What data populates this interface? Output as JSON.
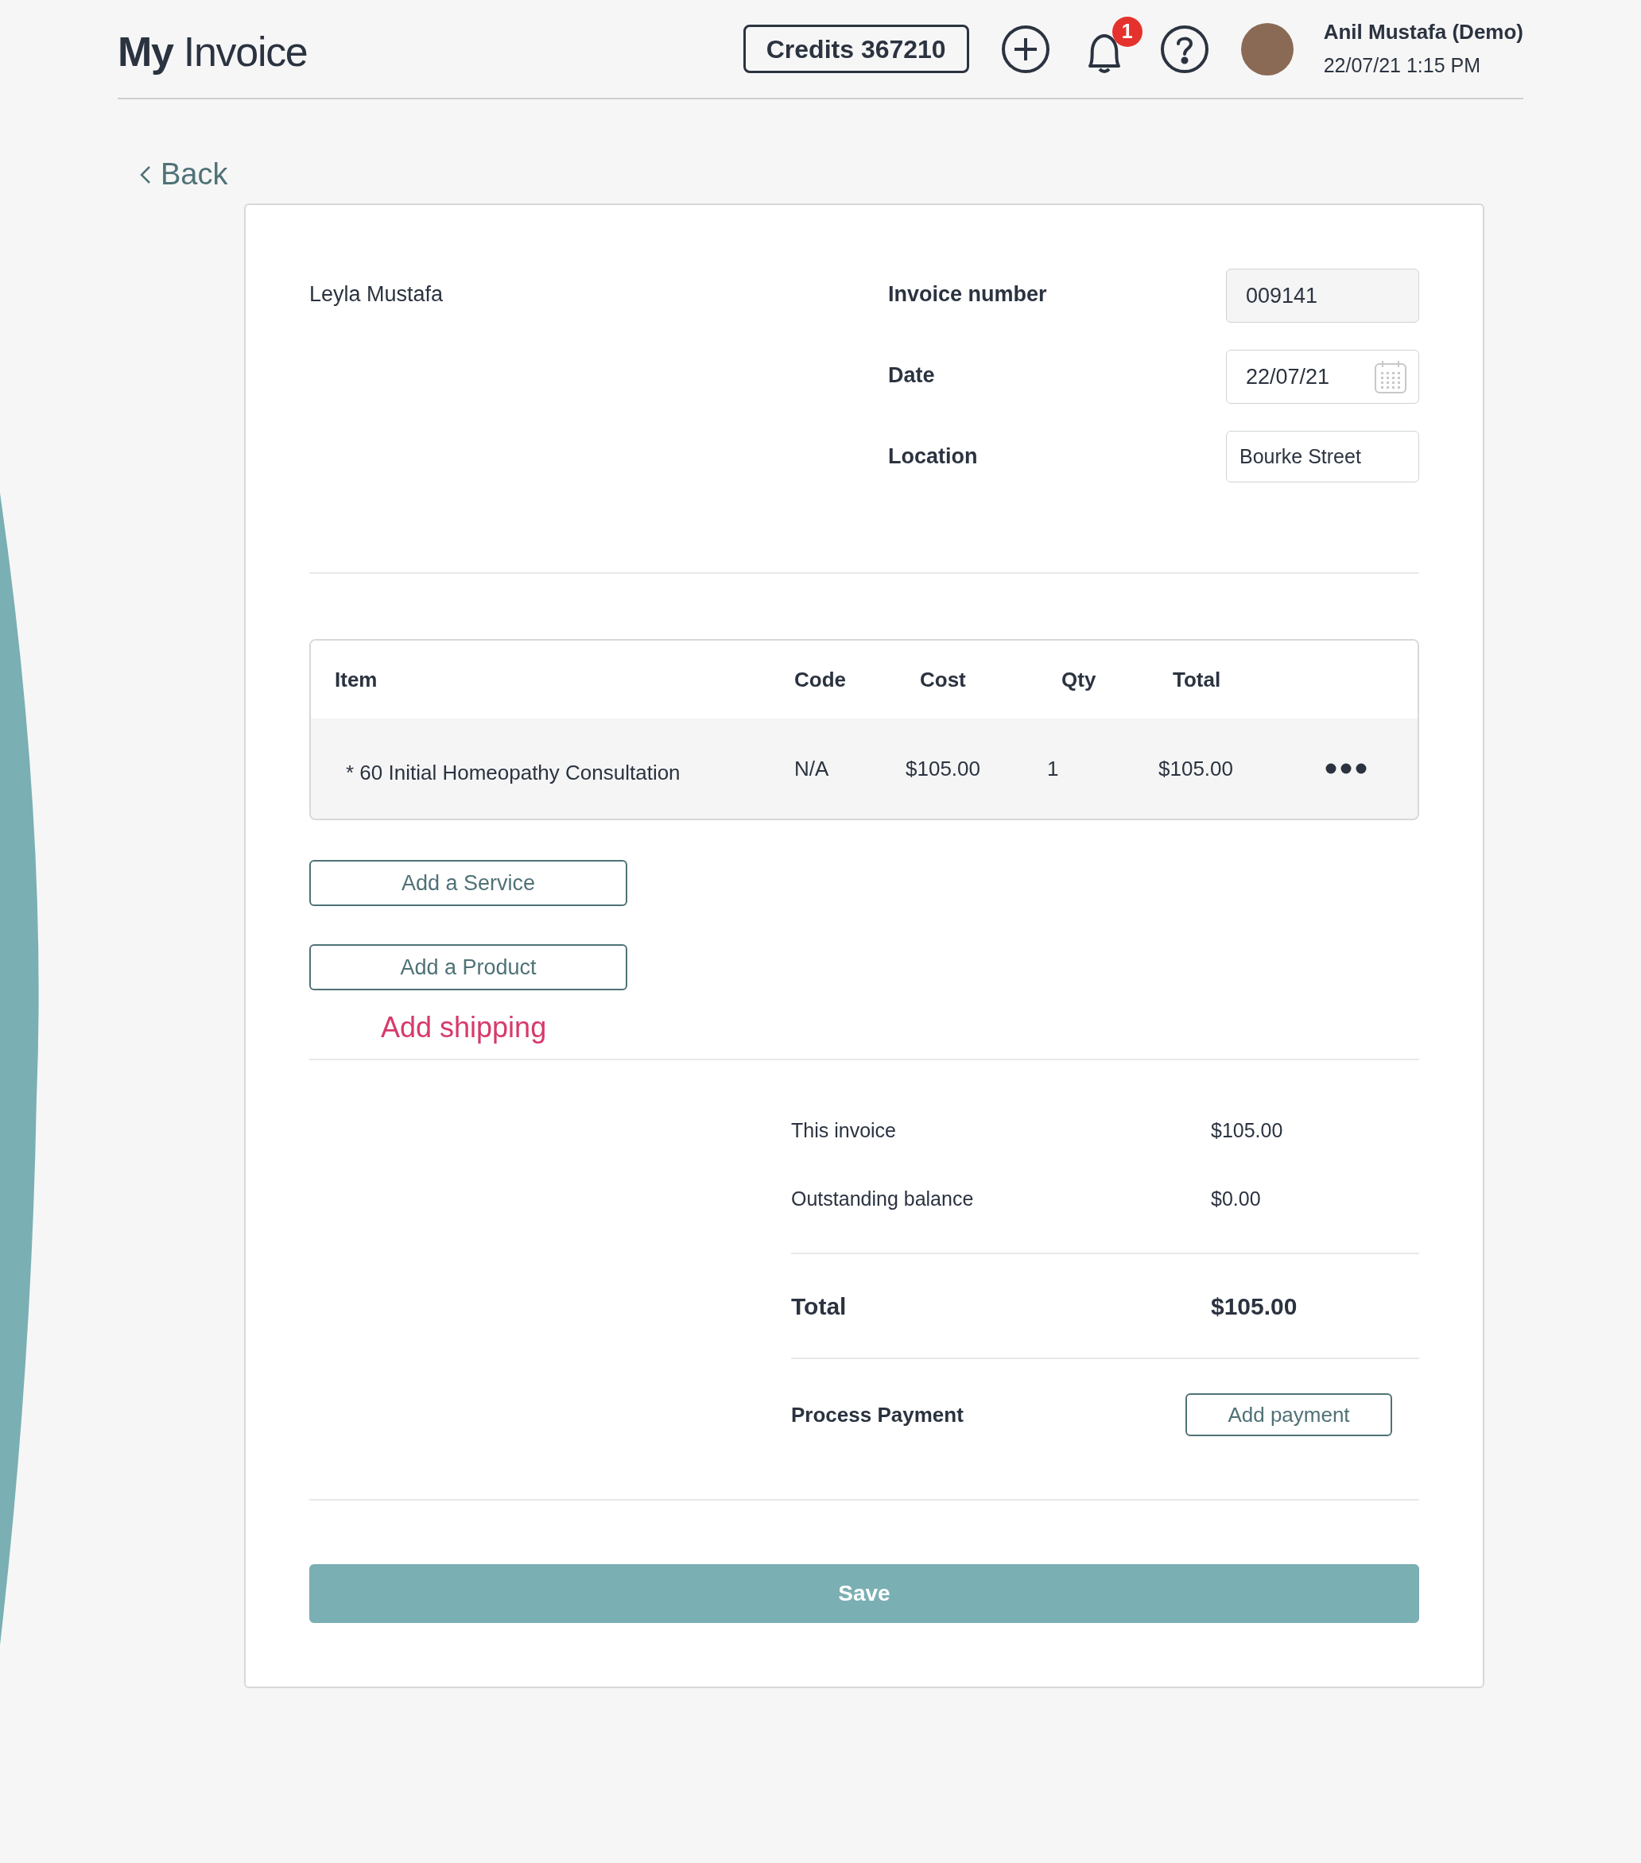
{
  "header": {
    "logo": "**My** Invoice",
    "credits": "Credits 367210",
    "notification_count": "1",
    "user_name": "Anil Mustafa (Demo)",
    "datetime": "22/07/21 1:15 PM"
  },
  "back": "Back",
  "customer": "Leyla Mustafa",
  "fields": [
    {
      "label": "Invoice number",
      "value": "009141",
      "kind": "readonly"
    },
    {
      "label": "Date",
      "value": "22/07/21",
      "kind": "date"
    },
    {
      "label": "Location",
      "value": "Bourke Street",
      "kind": "text"
    }
  ],
  "table": {
    "columns": [
      "Item",
      "Code",
      "Cost",
      "Qty",
      "Total"
    ],
    "rows": [
      {
        "cells": [
          "* 60 Initial Homeopathy Consultation",
          "N/A",
          "$105.00",
          "1",
          "$105.00"
        ]
      }
    ]
  },
  "add_buttons": [
    "Add a Service",
    "Add a Product"
  ],
  "add_shipping": "Add shipping",
  "summary": [
    {
      "label": "This invoice",
      "value": "$105.00"
    },
    {
      "label": "Outstanding balance",
      "value": "$0.00"
    }
  ],
  "total": {
    "label": "Total",
    "value": "$105.00"
  },
  "payment": {
    "label": "Process Payment",
    "button": "Add payment"
  },
  "save": "Save"
}
